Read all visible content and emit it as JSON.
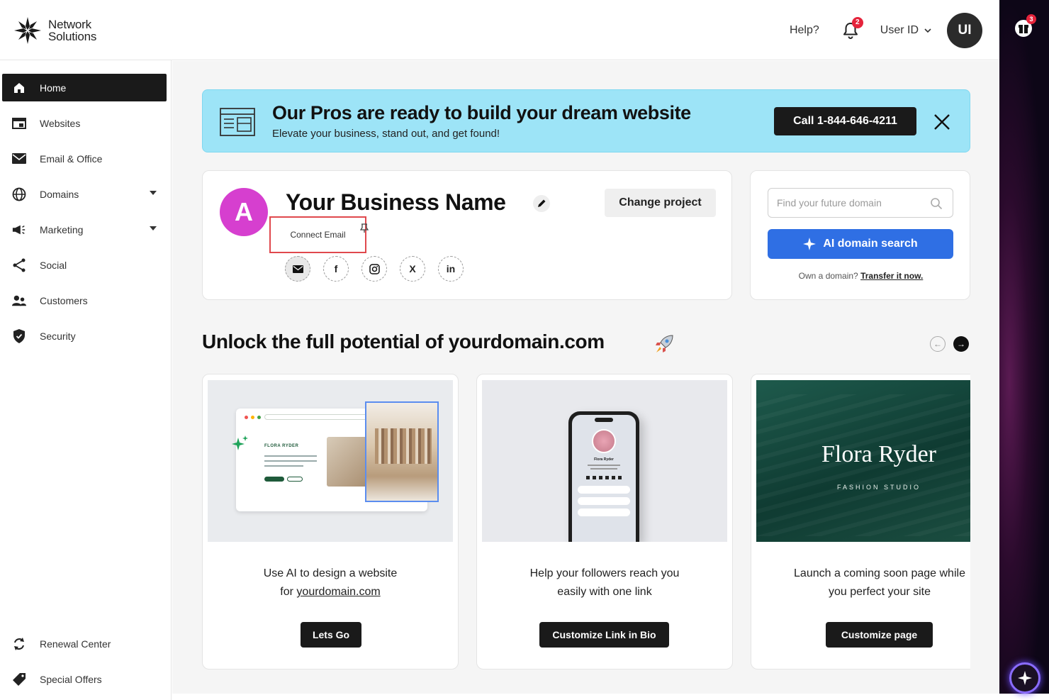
{
  "brand": {
    "line1": "Network",
    "line2": "Solutions"
  },
  "header": {
    "help": "Help?",
    "bell_count": "2",
    "user_id": "User ID",
    "avatar_initials": "UI"
  },
  "right_strip": {
    "gift_count": "3"
  },
  "sidebar": {
    "items": [
      {
        "label": "Home",
        "icon": "home-icon",
        "active": true
      },
      {
        "label": "Websites",
        "icon": "websites-icon"
      },
      {
        "label": "Email & Office",
        "icon": "email-icon"
      },
      {
        "label": "Domains",
        "icon": "globe-icon",
        "dropdown": true
      },
      {
        "label": "Marketing",
        "icon": "megaphone-icon",
        "dropdown": true
      },
      {
        "label": "Social",
        "icon": "share-icon"
      },
      {
        "label": "Customers",
        "icon": "customers-icon"
      },
      {
        "label": "Security",
        "icon": "shield-icon"
      }
    ],
    "bottom_items": [
      {
        "label": "Renewal Center",
        "icon": "renewal-icon"
      },
      {
        "label": "Special Offers",
        "icon": "tag-icon"
      }
    ]
  },
  "banner": {
    "title": "Our Pros are ready to build your dream website",
    "subtitle": "Elevate your business, stand out, and get found!",
    "call_label": "Call 1-844-646-4211"
  },
  "business": {
    "avatar_letter": "A",
    "name": "Your Business Name",
    "change_project": "Change project",
    "connect_email": "Connect Email",
    "socials": [
      "mail",
      "f",
      "instagram",
      "X",
      "in"
    ]
  },
  "domain_search": {
    "placeholder": "Find your future domain",
    "ai_button": "AI domain search",
    "own_text": "Own a domain?",
    "transfer_link": "Transfer it now."
  },
  "unlock": {
    "title": "Unlock the full potential of yourdomain.com"
  },
  "promos": [
    {
      "line1": "Use AI to design a website",
      "line2_prefix": "for ",
      "line2_link": "yourdomain.com",
      "button": "Lets Go",
      "brand_text": "FLORA RYDER"
    },
    {
      "line1": "Help your followers reach you",
      "line2": "easily with one link",
      "button": "Customize Link in Bio",
      "phone_name": "Flora Ryder"
    },
    {
      "line1": "Launch a coming soon page while",
      "line2": "you perfect your site",
      "button": "Customize  page",
      "hero_title": "Flora Ryder",
      "hero_sub": "FASHION STUDIO"
    }
  ],
  "colors": {
    "banner_bg": "#9de4f7",
    "primary_blue": "#2f6fe4",
    "avatar_magenta": "#d63fcf",
    "highlight_red": "#e0484d"
  }
}
